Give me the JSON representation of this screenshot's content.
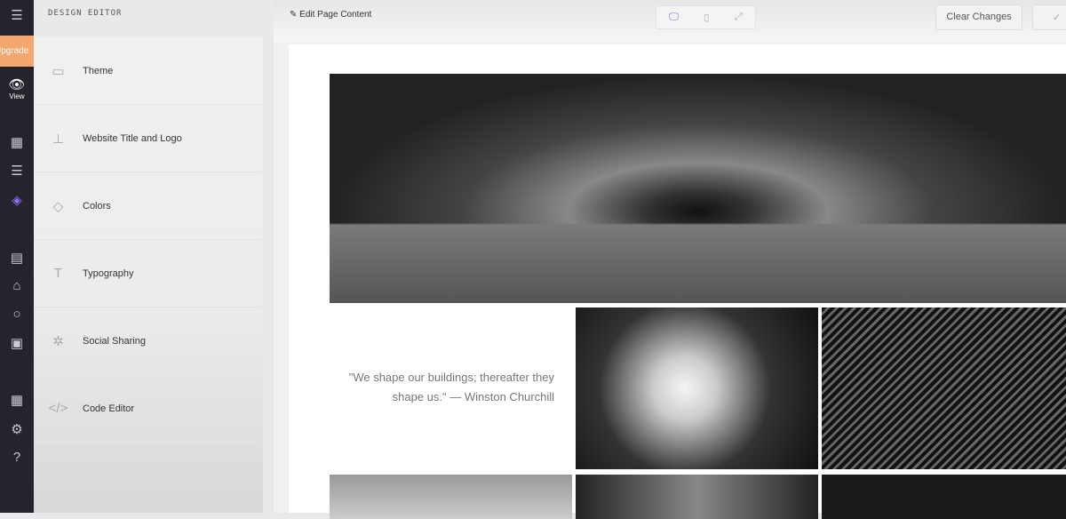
{
  "rail": {
    "upgrade": "Upgrade",
    "view": "View"
  },
  "panel": {
    "title": "DESIGN EDITOR",
    "items": [
      {
        "label": "Theme"
      },
      {
        "label": "Website Title and Logo"
      },
      {
        "label": "Colors"
      },
      {
        "label": "Typography"
      },
      {
        "label": "Social Sharing"
      },
      {
        "label": "Code Editor"
      }
    ]
  },
  "topbar": {
    "edit": "Edit Page Content",
    "clear": "Clear Changes",
    "confirm": "✓"
  },
  "content": {
    "quote": "\"We shape our buildings; thereafter they shape us.\" — Winston Churchill"
  }
}
